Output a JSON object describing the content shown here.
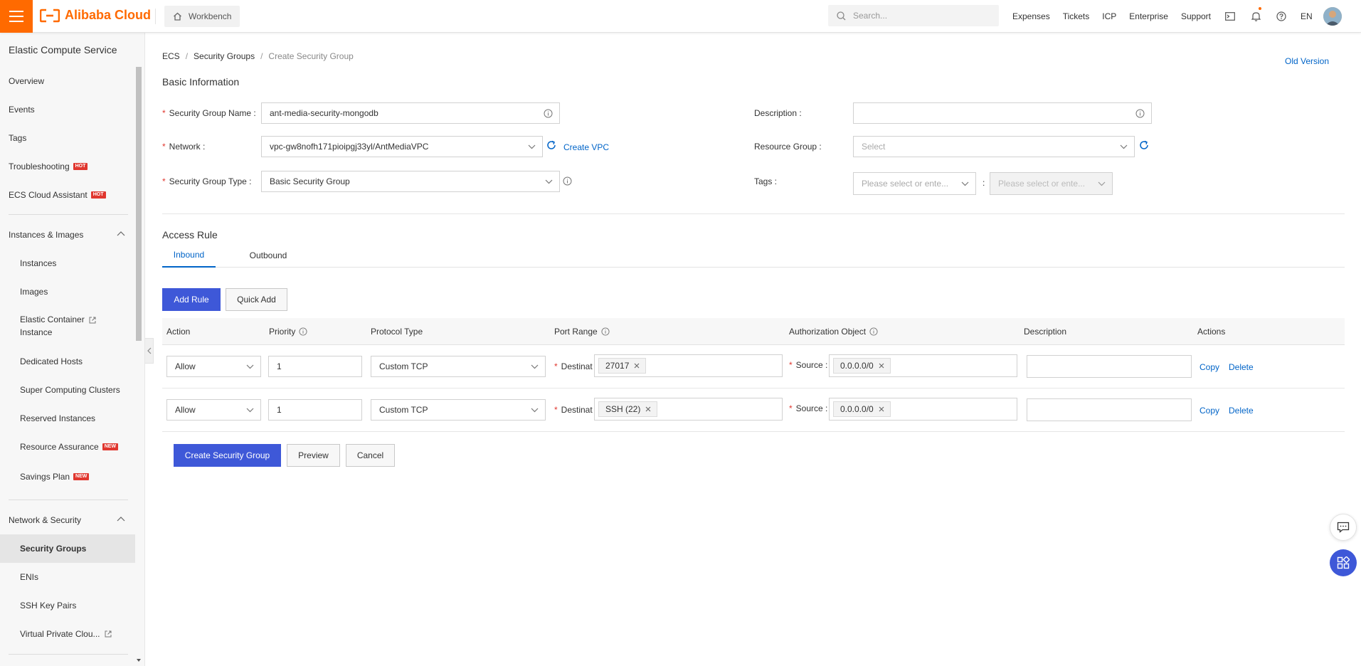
{
  "header": {
    "brand": "Alibaba Cloud",
    "workbench": "Workbench",
    "search_placeholder": "Search...",
    "links": [
      "Expenses",
      "Tickets",
      "ICP",
      "Enterprise",
      "Support"
    ],
    "language": "EN"
  },
  "sidebar": {
    "title": "Elastic Compute Service",
    "items_top": [
      {
        "label": "Overview"
      },
      {
        "label": "Events"
      },
      {
        "label": "Tags"
      },
      {
        "label": "Troubleshooting",
        "badge": "HOT"
      },
      {
        "label": "ECS Cloud Assistant",
        "badge": "HOT"
      }
    ],
    "group_instances": "Instances & Images",
    "instances_items": {
      "instances": "Instances",
      "images": "Images",
      "eci_line1": "Elastic Container",
      "eci_line2": "Instance",
      "dedicated_hosts": "Dedicated Hosts",
      "super_computing": "Super Computing Clusters",
      "reserved": "Reserved Instances",
      "resource_assurance": "Resource Assurance",
      "resource_assurance_badge": "NEW",
      "savings_plan": "Savings Plan",
      "savings_plan_badge": "NEW"
    },
    "group_network": "Network & Security",
    "network_items": {
      "security_groups": "Security Groups",
      "enis": "ENIs",
      "ssh_key_pairs": "SSH Key Pairs",
      "vpc": "Virtual Private Clou..."
    }
  },
  "breadcrumb": {
    "ecs": "ECS",
    "security_groups": "Security Groups",
    "current": "Create Security Group",
    "sep": "/"
  },
  "old_version": "Old Version",
  "basic": {
    "title": "Basic Information",
    "name_label": "Security Group Name :",
    "name_value": "ant-media-security-mongodb",
    "network_label": "Network :",
    "network_value": "vpc-gw8nofh171pioipgj33yl/AntMediaVPC",
    "create_vpc": "Create VPC",
    "type_label": "Security Group Type :",
    "type_value": "Basic Security Group",
    "description_label": "Description :",
    "description_value": "",
    "resource_group_label": "Resource Group :",
    "resource_group_placeholder": "Select",
    "tags_label": "Tags :",
    "tag_key_placeholder": "Please select or ente...",
    "tag_colon": ":",
    "tag_value_placeholder": "Please select or ente..."
  },
  "access": {
    "title": "Access Rule",
    "tabs": [
      "Inbound",
      "Outbound"
    ],
    "add_rule": "Add Rule",
    "quick_add": "Quick Add",
    "columns": [
      "Action",
      "Priority",
      "Protocol Type",
      "Port Range",
      "Authorization Object",
      "Description",
      "Actions"
    ],
    "rows": [
      {
        "action": "Allow",
        "priority": "1",
        "protocol": "Custom TCP",
        "dest_label": "Destinat",
        "port": "27017",
        "source_label": "Source :",
        "source": "0.0.0.0/0",
        "description": "",
        "copy": "Copy",
        "delete": "Delete"
      },
      {
        "action": "Allow",
        "priority": "1",
        "protocol": "Custom TCP",
        "dest_label": "Destinat",
        "port": "SSH (22)",
        "source_label": "Source :",
        "source": "0.0.0.0/0",
        "description": "",
        "copy": "Copy",
        "delete": "Delete"
      }
    ]
  },
  "footer_buttons": {
    "create": "Create Security Group",
    "preview": "Preview",
    "cancel": "Cancel"
  },
  "colors": {
    "brand_orange": "#ff6a00",
    "primary_blue": "#3e58d8",
    "link_blue": "#0064c8",
    "required_red": "#e0372f"
  }
}
